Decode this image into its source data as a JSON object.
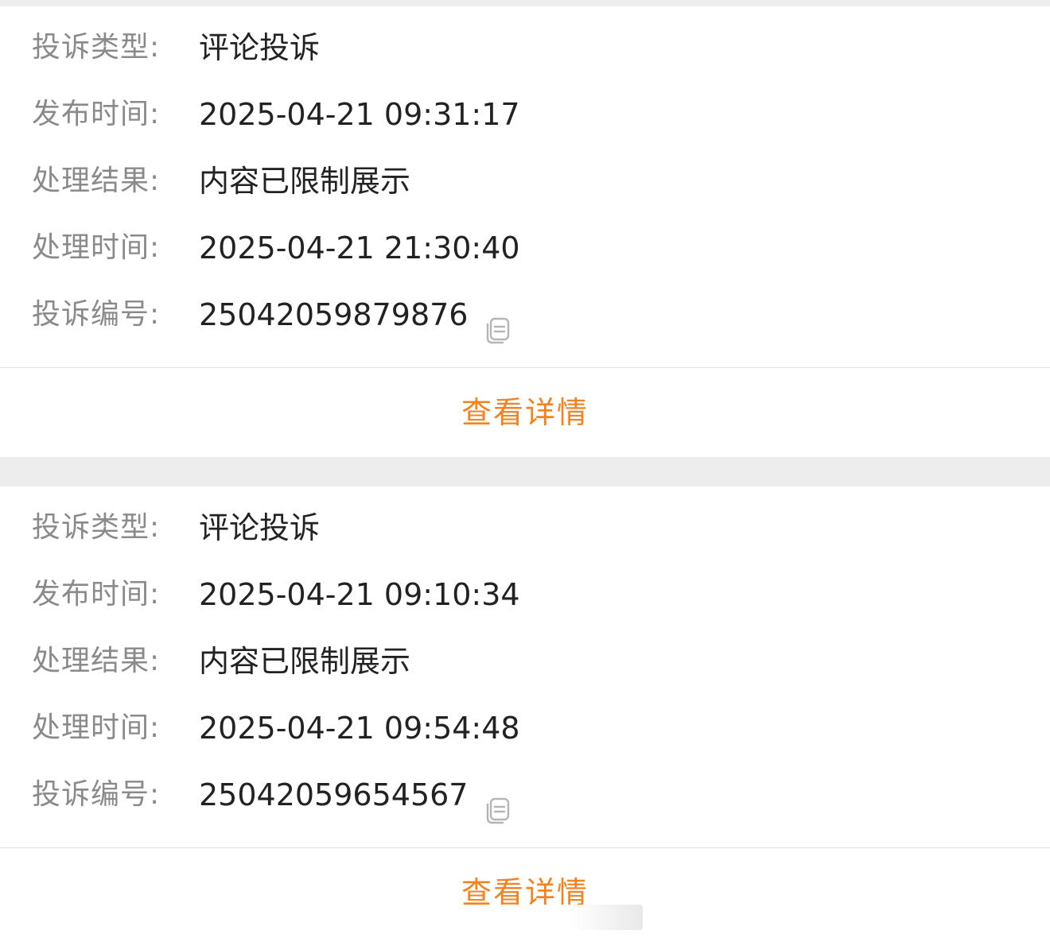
{
  "colors": {
    "background": "#ededed",
    "card": "#ffffff",
    "label": "#8a8a8a",
    "value": "#222222",
    "accent": "#f5821f",
    "divider": "#e4e4e4"
  },
  "records": [
    {
      "type_label": "投诉类型:",
      "type_value": "评论投诉",
      "publish_label": "发布时间:",
      "publish_value": "2025-04-21 09:31:17",
      "result_label": "处理结果:",
      "result_value": "内容已限制展示",
      "handle_label": "处理时间:",
      "handle_value": "2025-04-21 21:30:40",
      "id_label": "投诉编号:",
      "id_value": "25042059879876",
      "copy_icon": "copy-icon",
      "detail_label": "查看详情"
    },
    {
      "type_label": "投诉类型:",
      "type_value": "评论投诉",
      "publish_label": "发布时间:",
      "publish_value": "2025-04-21 09:10:34",
      "result_label": "处理结果:",
      "result_value": "内容已限制展示",
      "handle_label": "处理时间:",
      "handle_value": "2025-04-21 09:54:48",
      "id_label": "投诉编号:",
      "id_value": "25042059654567",
      "copy_icon": "copy-icon",
      "detail_label": "查看详情"
    }
  ]
}
